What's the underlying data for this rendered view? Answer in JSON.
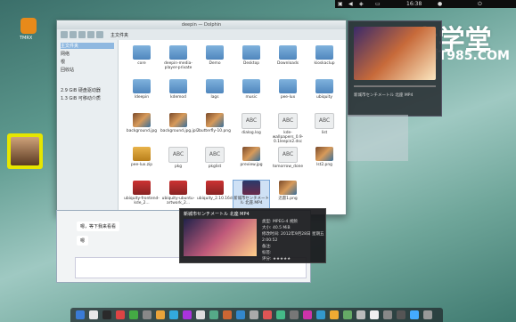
{
  "topbar": {
    "time": "16:38"
  },
  "desktop": {
    "icon1_label": "TMRX"
  },
  "watermark": {
    "line1": "IT大学堂",
    "line2": "WWW.IT985.COM"
  },
  "file_manager": {
    "title": "deepin — Dolphin",
    "path": "主文件夹",
    "sidebar": [
      "主文件夹",
      "网络",
      "根",
      "回收站",
      "",
      "2.9 GiB 硬盘驱动器",
      "1.3 GiB 可移动介质"
    ],
    "files": [
      {
        "name": "core",
        "type": "folder"
      },
      {
        "name": "deepin-media-player-private",
        "type": "folder"
      },
      {
        "name": "Demo",
        "type": "folder"
      },
      {
        "name": "Desktop",
        "type": "folder"
      },
      {
        "name": "Downloads",
        "type": "folder"
      },
      {
        "name": "kioskaclup",
        "type": "folder"
      },
      {
        "name": "ldeepin",
        "type": "folder"
      },
      {
        "name": "kdemod",
        "type": "folder"
      },
      {
        "name": "lags",
        "type": "folder"
      },
      {
        "name": "music",
        "type": "folder"
      },
      {
        "name": "pee-lux",
        "type": "folder"
      },
      {
        "name": "ubiquity",
        "type": "folder"
      },
      {
        "name": "background.jpg",
        "type": "pic"
      },
      {
        "name": "background.jpg.jpl2",
        "type": "pic"
      },
      {
        "name": "butterfly-10.png",
        "type": "pic"
      },
      {
        "name": "dialog.log",
        "type": "abc"
      },
      {
        "name": "kde-wallpapers_0.9-0.1leepin2.dsc",
        "type": "abc"
      },
      {
        "name": "list",
        "type": "abc"
      },
      {
        "name": "pee-lux.zip",
        "type": "zip"
      },
      {
        "name": "pkg",
        "type": "abc"
      },
      {
        "name": "pkglist",
        "type": "abc"
      },
      {
        "name": "preview.jpg",
        "type": "pic"
      },
      {
        "name": "tomorrow_done",
        "type": "abc"
      },
      {
        "name": "lst2.png",
        "type": "pic"
      },
      {
        "name": "ubiquity-frontend-kde_2...",
        "type": "pkg"
      },
      {
        "name": "ubiquity-ubuntu-artwork_2...",
        "type": "pkg"
      },
      {
        "name": "ubiquity_2.10.16deepin9_amd...",
        "type": "pkg"
      },
      {
        "name": "新城市センチメートル 北座.MP4",
        "type": "vid"
      },
      {
        "name": "迅雷1.png",
        "type": "pic"
      }
    ]
  },
  "player": {
    "title": "新城市センチメートル 北座 MP4",
    "rating_label": "评分"
  },
  "popup": {
    "title": "新城市センチメートル 北座 MP4",
    "type_label": "类型:",
    "type_value": "MPEG-4 视频",
    "size_label": "大小:",
    "size_value": "40.5 MiB",
    "modified_label": "修改时间:",
    "modified_value": "2012年9月28日 星期五 2:00:52",
    "comment_label": "备注:",
    "tags_label": "标签:",
    "rating_label": "评分:",
    "rating_value": "★★★★★"
  },
  "chat": {
    "msg1": "嗯，等下我来看看",
    "msg2": "嗯"
  }
}
